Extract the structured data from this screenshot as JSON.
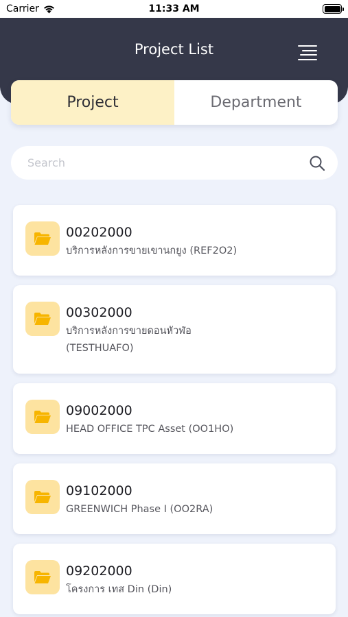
{
  "status_bar": {
    "carrier": "Carrier",
    "time": "11:33 AM"
  },
  "header": {
    "title": "Project List"
  },
  "tabs": [
    {
      "label": "Project",
      "active": true
    },
    {
      "label": "Department",
      "active": false
    }
  ],
  "search": {
    "placeholder": "Search",
    "value": ""
  },
  "projects": [
    {
      "code": "00202000",
      "name": "บริการหลังการขายเขานกยูง (REF2O2)"
    },
    {
      "code": "00302000",
      "name": "บริการหลังการขายดอนหัวฬ่อ (TESTHUAFO)"
    },
    {
      "code": "09002000",
      "name": "HEAD OFFICE TPC Asset (OO1HO)"
    },
    {
      "code": "09102000",
      "name": "GREENWICH Phase I (OO2RA)"
    },
    {
      "code": "09202000",
      "name": "โครงการ เทส Din (Din)"
    }
  ],
  "colors": {
    "header_bg": "#353849",
    "page_bg": "#eef2fb",
    "active_tab_bg": "#fdf1c6",
    "folder_bg": "#fde3a0",
    "folder_icon": "#f7b500"
  },
  "icons": {
    "menu": "menu-icon",
    "search": "search-icon",
    "folder": "folder-icon"
  }
}
